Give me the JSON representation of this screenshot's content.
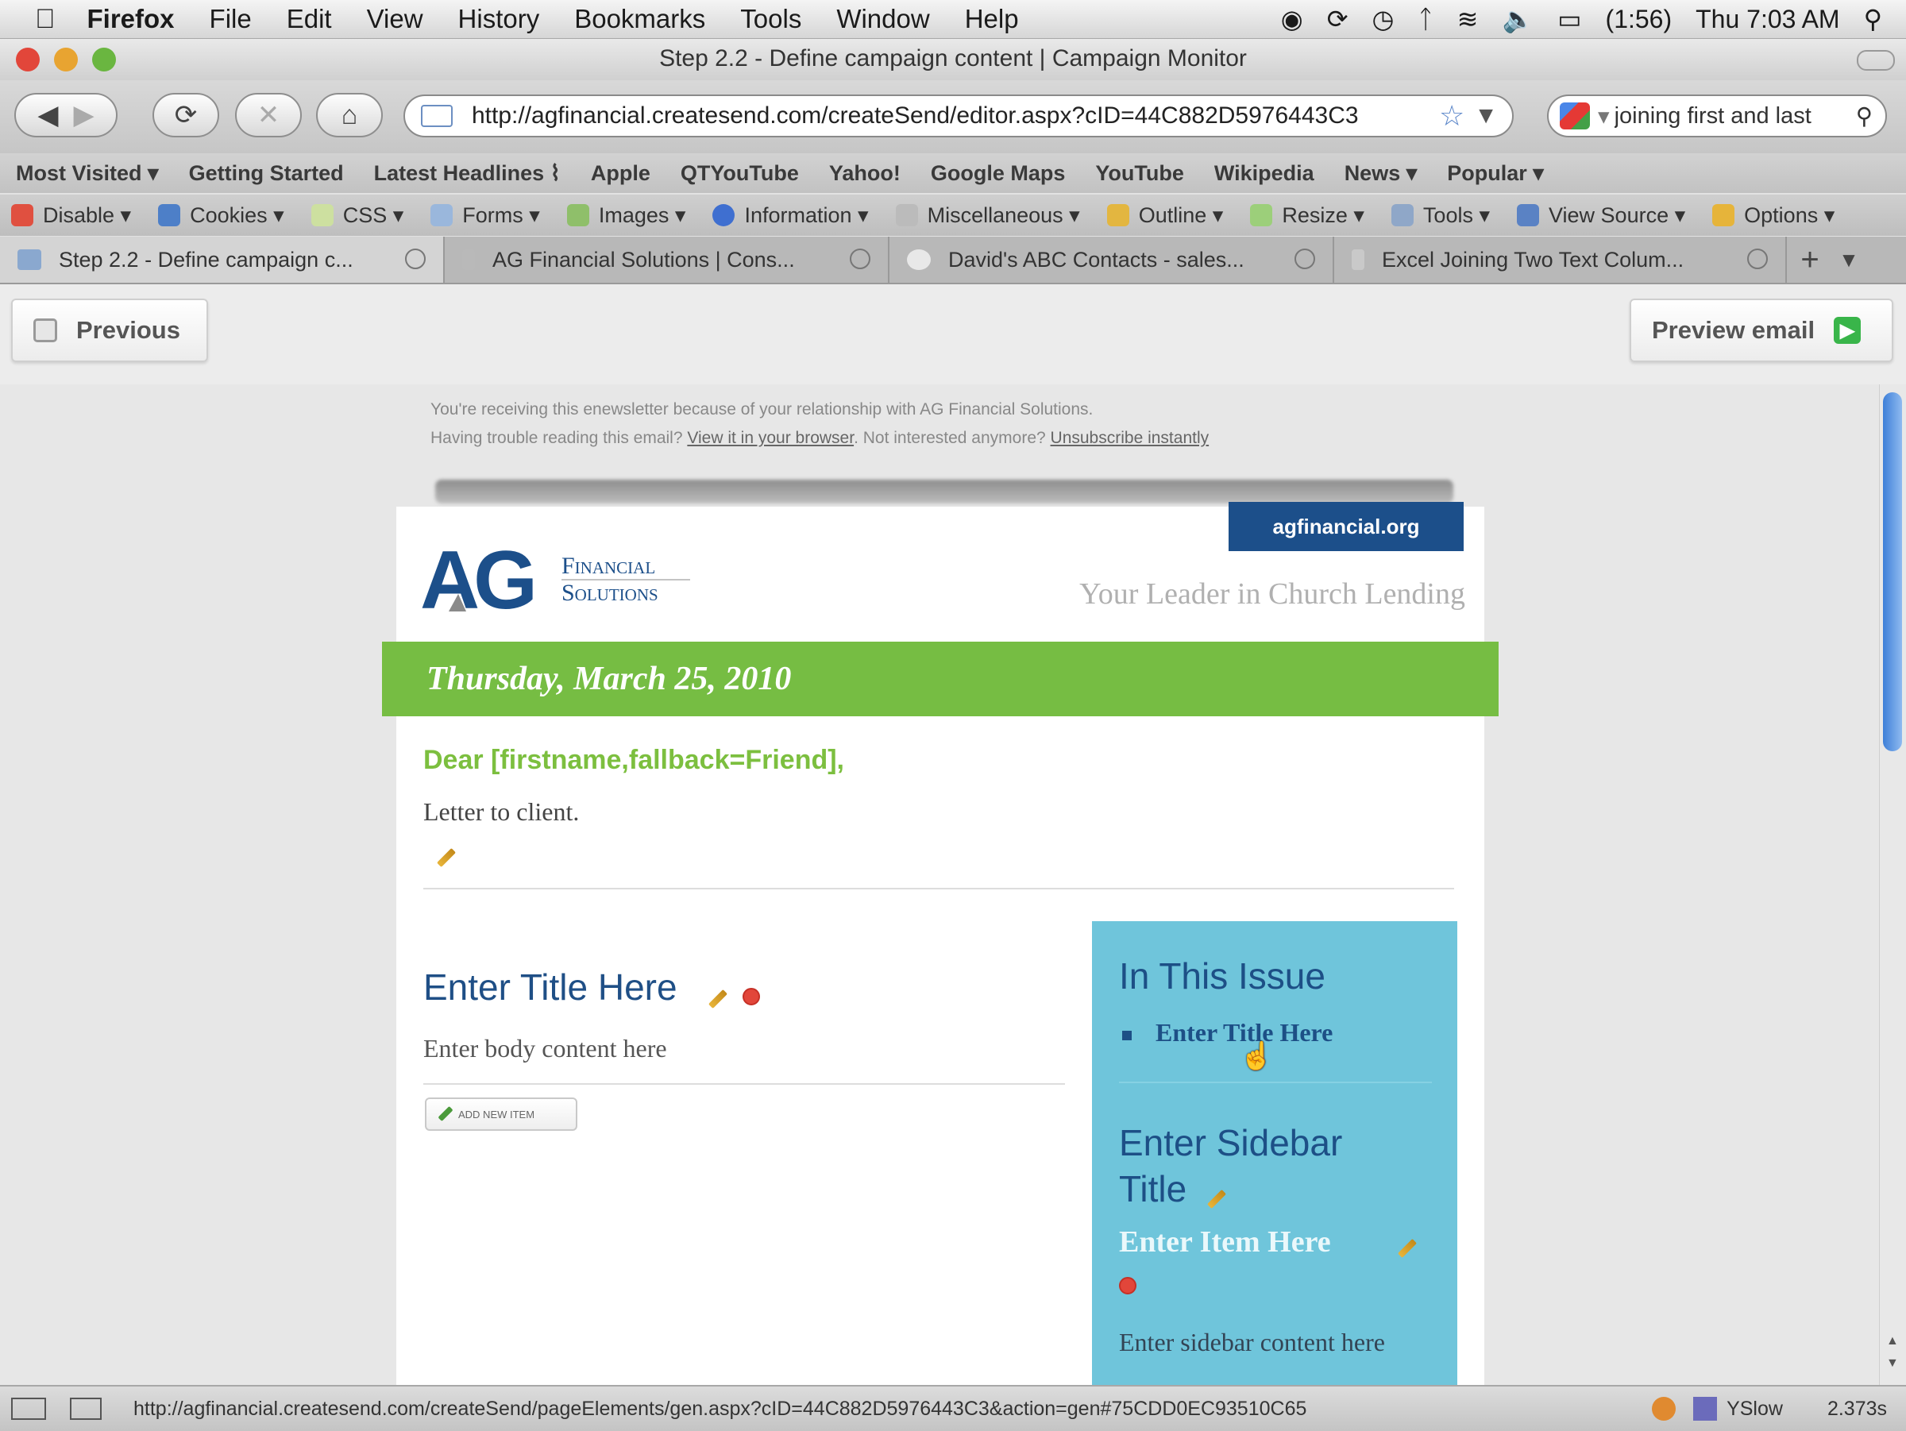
{
  "menubar": {
    "app": "Firefox",
    "items": [
      "File",
      "Edit",
      "View",
      "History",
      "Bookmarks",
      "Tools",
      "Window",
      "Help"
    ],
    "battery": "(1:56)",
    "clock": "Thu 7:03 AM"
  },
  "window": {
    "title": "Step 2.2 - Define campaign content | Campaign Monitor"
  },
  "nav": {
    "url": "http://agfinancial.createsend.com/createSend/editor.aspx?cID=44C882D5976443C3",
    "search_value": "joining first and last"
  },
  "bookmarks": [
    "Most Visited ▾",
    "Getting Started",
    "Latest Headlines ⁠⌇",
    "Apple",
    "QTYouTube",
    "Yahoo!",
    "Google Maps",
    "YouTube",
    "Wikipedia",
    "News ▾",
    "Popular ▾"
  ],
  "devtoolbar": [
    "Disable ▾",
    "Cookies ▾",
    "CSS ▾",
    "Forms ▾",
    "Images ▾",
    "Information ▾",
    "Miscellaneous ▾",
    "Outline ▾",
    "Resize ▾",
    "Tools ▾",
    "View Source ▾",
    "Options ▾"
  ],
  "tabs": [
    {
      "label": "Step 2.2 - Define campaign c...",
      "active": true
    },
    {
      "label": "AG Financial Solutions | Cons...",
      "active": false
    },
    {
      "label": "David's ABC Contacts - sales...",
      "active": false
    },
    {
      "label": "Excel Joining Two Text Colum...",
      "active": false
    }
  ],
  "campaign": {
    "previous_label": "Previous",
    "preview_label": "Preview email"
  },
  "email": {
    "pre_line1": "You're receiving this enewsletter because of your relationship with AG Financial Solutions.",
    "pre_line2_a": "Having trouble reading this email?",
    "pre_link1": "View it in your browser",
    "pre_line2_b": ". Not interested anymore?",
    "pre_link2": "Unsubscribe instantly",
    "site_link": "agfinancial.org",
    "logo_main": "AG",
    "logo_line1": "Financial",
    "logo_line2": "Solutions",
    "tagline": "Your Leader in Church Lending",
    "date": "Thursday, March 25, 2010",
    "greeting": "Dear [firstname,fallback=Friend],",
    "letter": "Letter to client.",
    "article_title": "Enter Title Here",
    "article_body": "Enter body content here",
    "add_item": "Add new item",
    "sidebar": {
      "heading": "In This Issue",
      "link": "Enter Title Here",
      "title": "Enter Sidebar Title",
      "item": "Enter Item Here",
      "content": "Enter sidebar content here"
    }
  },
  "status": {
    "url": "http://agfinancial.createsend.com/createSend/pageElements/gen.aspx?cID=44C882D5976443C3&action=gen#75CDD0EC93510C65",
    "yslow": "YSlow",
    "time": "2.373s"
  },
  "colors": {
    "green": "#76bd43",
    "navy": "#1c4f8a",
    "sidebar": "#6fc5db"
  }
}
